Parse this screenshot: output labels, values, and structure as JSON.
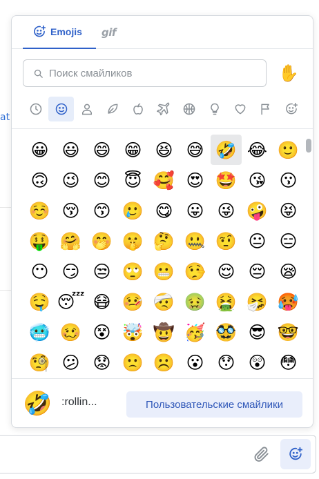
{
  "background": {
    "left_fragment_text": "at"
  },
  "picker": {
    "tabs": [
      {
        "label": "Emojis",
        "active": true,
        "icon": "smiley-plus-icon"
      },
      {
        "label": "gif",
        "active": false,
        "icon": "gif-icon"
      }
    ],
    "search": {
      "placeholder": "Поиск смайликов",
      "value": ""
    },
    "skin_tone": {
      "emoji": "✋"
    },
    "categories": [
      {
        "name": "recent",
        "icon": "clock-icon",
        "active": false
      },
      {
        "name": "smileys",
        "icon": "smiley-icon",
        "active": true
      },
      {
        "name": "people",
        "icon": "person-icon",
        "active": false
      },
      {
        "name": "nature",
        "icon": "leaf-icon",
        "active": false
      },
      {
        "name": "food",
        "icon": "apple-icon",
        "active": false
      },
      {
        "name": "travel",
        "icon": "airplane-icon",
        "active": false
      },
      {
        "name": "activities",
        "icon": "ball-icon",
        "active": false
      },
      {
        "name": "objects",
        "icon": "lightbulb-icon",
        "active": false
      },
      {
        "name": "symbols",
        "icon": "heart-icon",
        "active": false
      },
      {
        "name": "flags",
        "icon": "flag-icon",
        "active": false
      },
      {
        "name": "custom",
        "icon": "smiley-plus-icon",
        "active": false
      }
    ],
    "emoji_rows": [
      [
        "😀",
        "😃",
        "😄",
        "😁",
        "😆",
        "😅",
        "🤣",
        "😂",
        "🙂"
      ],
      [
        "🙃",
        "😉",
        "😊",
        "😇",
        "🥰",
        "😍",
        "🤩",
        "😘",
        "😗"
      ],
      [
        "☺️",
        "😚",
        "😙",
        "🥲",
        "😋",
        "😛",
        "😜",
        "🤪",
        "😝"
      ],
      [
        "🤑",
        "🤗",
        "🤭",
        "🤫",
        "🤔",
        "🤐",
        "🤨",
        "😐",
        "😑"
      ],
      [
        "😶",
        "😏",
        "😒",
        "🙄",
        "😬",
        "🤥",
        "😌",
        "😔",
        "😪"
      ],
      [
        "🤤",
        "😴",
        "😷",
        "🤒",
        "🤕",
        "🤢",
        "🤮",
        "🤧",
        "🥵"
      ],
      [
        "🥶",
        "🥴",
        "😵",
        "🤯",
        "🤠",
        "🥳",
        "🥸",
        "😎",
        "🤓"
      ],
      [
        "🧐",
        "😕",
        "😟",
        "🙁",
        "☹️",
        "😮",
        "😯",
        "😲",
        "😳"
      ]
    ],
    "hovered_emoji": "🤣",
    "footer": {
      "preview_emoji": "🤣",
      "preview_name": ":rollin...",
      "custom_button_label": "Пользовательские смайлики"
    },
    "scroll_position": 0.0
  },
  "composer": {
    "attach_icon": "paperclip-icon",
    "emoji_button_icon": "smiley-plus-icon"
  },
  "colors": {
    "accent": "#2f61c9",
    "active_bg": "#e6edfa",
    "button_bg": "#e9eefb",
    "icon_gray": "#8a9096"
  }
}
